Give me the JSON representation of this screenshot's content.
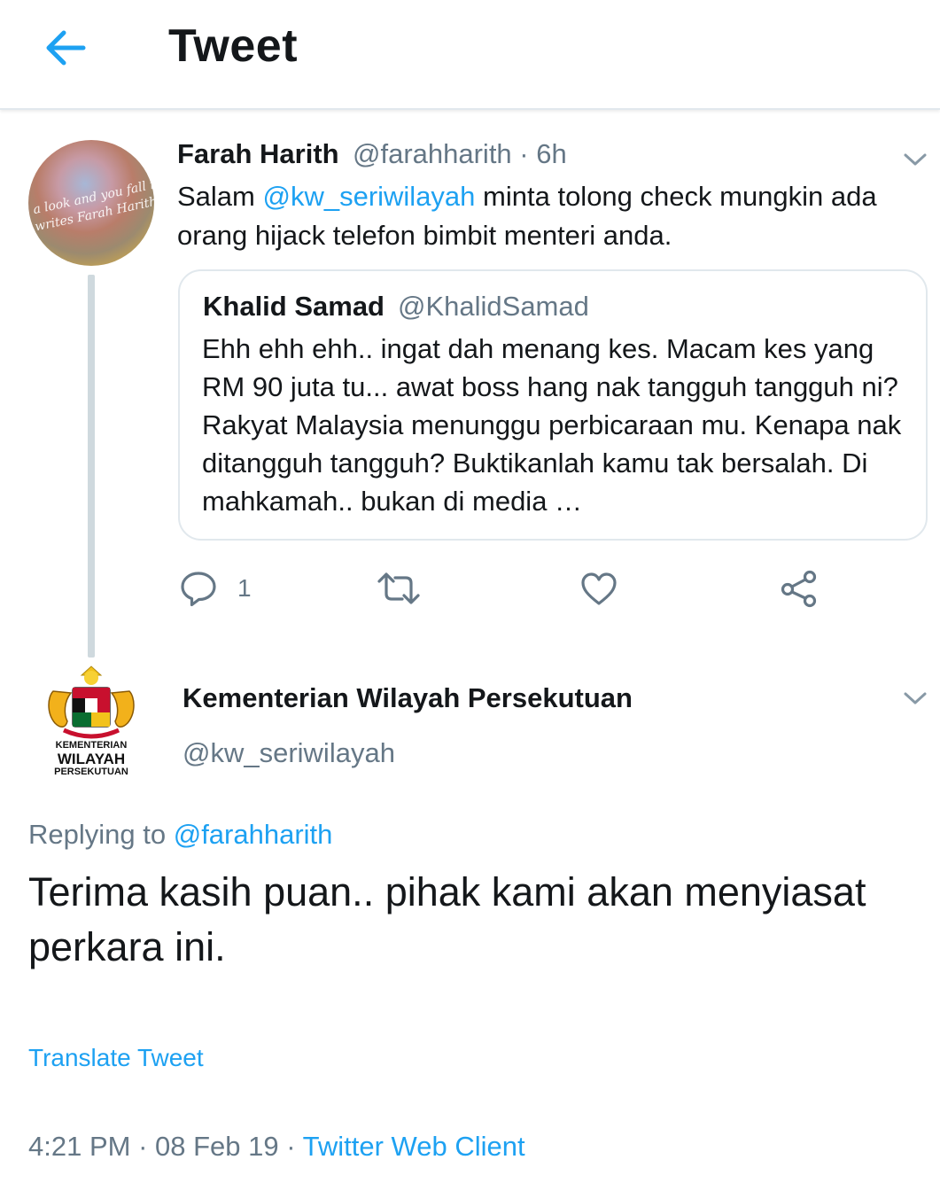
{
  "header": {
    "title": "Tweet",
    "back_icon": "arrow-left-icon"
  },
  "colors": {
    "accent": "#1da1f2",
    "secondary_text": "#657786",
    "primary_text": "#14171a",
    "border": "#e1e8ed"
  },
  "tweet1": {
    "name": "Farah Harith",
    "handle": "@farahharith",
    "time": "6h",
    "text_prefix": "Salam ",
    "mention": "@kw_seriwilayah",
    "text_suffix": " minta tolong check mungkin ada orang hijack telefon bimbit menteri anda.",
    "avatar_text": [
      "a look and you fall in",
      "writes Farah Harith"
    ],
    "quote": {
      "name": "Khalid Samad",
      "handle": "@KhalidSamad",
      "text": "Ehh ehh ehh.. ingat dah menang kes. Macam kes yang RM 90 juta tu... awat boss hang nak tangguh tangguh ni? Rakyat Malaysia menunggu perbicaraan mu. Kenapa nak ditangguh tangguh? Buktikanlah kamu tak bersalah. Di mahkamah.. bukan di media …"
    },
    "actions": {
      "reply_count": "1",
      "icons": [
        "reply-icon",
        "retweet-icon",
        "like-icon",
        "share-icon"
      ]
    }
  },
  "tweet2": {
    "name": "Kementerian Wilayah Persekutuan",
    "handle": "@kw_seriwilayah",
    "logo_text": [
      "KEMENTERIAN",
      "WILAYAH",
      "PERSEKUTUAN"
    ],
    "replying_label": "Replying to ",
    "replying_to": "@farahharith",
    "text": "Terima kasih puan.. pihak kami akan menyiasat perkara ini.",
    "translate_label": "Translate Tweet",
    "time": "4:21 PM",
    "date": "08 Feb 19",
    "separator": " · ",
    "client": "Twitter Web Client"
  }
}
